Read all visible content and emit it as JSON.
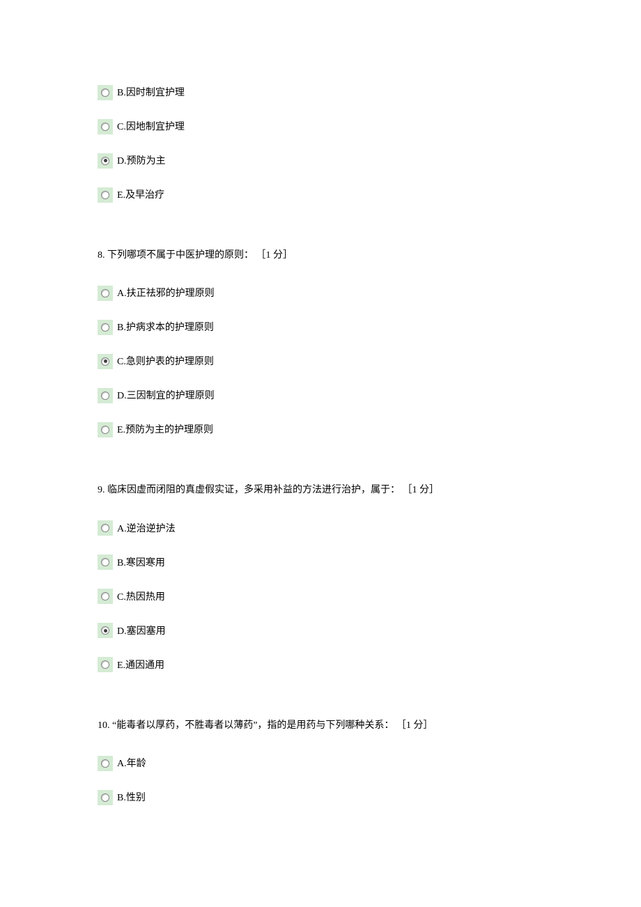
{
  "q7": {
    "options": [
      {
        "label": "B.因时制宜护理",
        "selected": false
      },
      {
        "label": "C.因地制宜护理",
        "selected": false
      },
      {
        "label": "D.预防为主",
        "selected": true
      },
      {
        "label": "E.及早治疗",
        "selected": false
      }
    ]
  },
  "q8": {
    "stem": "8. 下列哪项不属于中医护理的原则： ［1 分］",
    "options": [
      {
        "label": "A.扶正祛邪的护理原则",
        "selected": false
      },
      {
        "label": "B.护病求本的护理原则",
        "selected": false
      },
      {
        "label": "C.急则护表的护理原则",
        "selected": true
      },
      {
        "label": "D.三因制宜的护理原则",
        "selected": false
      },
      {
        "label": "E.预防为主的护理原则",
        "selected": false
      }
    ]
  },
  "q9": {
    "stem": "9. 临床因虚而闭阻的真虚假实证，多采用补益的方法进行治护，属于： ［1 分］",
    "options": [
      {
        "label": "A.逆治逆护法",
        "selected": false
      },
      {
        "label": "B.寒因寒用",
        "selected": false
      },
      {
        "label": "C.热因热用",
        "selected": false
      },
      {
        "label": "D.塞因塞用",
        "selected": true
      },
      {
        "label": "E.通因通用",
        "selected": false
      }
    ]
  },
  "q10": {
    "stem": "10. “能毒者以厚药，不胜毒者以薄药”，指的是用药与下列哪种关系： ［1 分］",
    "options": [
      {
        "label": "A.年龄",
        "selected": false
      },
      {
        "label": "B.性别",
        "selected": false
      }
    ]
  }
}
